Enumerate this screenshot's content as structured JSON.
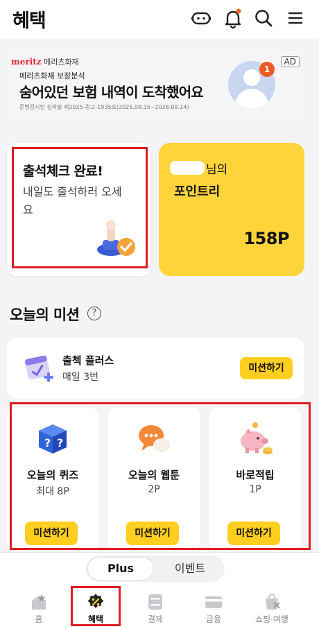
{
  "header": {
    "title": "혜택"
  },
  "ad": {
    "brand_logo": "meritz",
    "brand_name": "메리츠화재",
    "subtitle": "메리츠화재 보장분석",
    "headline": "숨어있던 보험 내역이 도착했어요",
    "legal": "준법감시인 심의필 제2025-광고-1935호(2025.09.15~2026.09.14)",
    "badge_count": "1",
    "ad_tag": "AD"
  },
  "attendance": {
    "title": "출석체크 완료!",
    "message": "내일도 출석하러 오세요"
  },
  "point": {
    "name_suffix": "님의",
    "label": "포인트리",
    "amount": "158P"
  },
  "missions": {
    "section_title": "오늘의 미션",
    "help": "?",
    "plus": {
      "title": "출첵 플러스",
      "subtitle": "매일 3번",
      "button": "미션하기"
    },
    "items": [
      {
        "title": "오늘의 퀴즈",
        "reward": "최대 8P",
        "button": "미션하기"
      },
      {
        "title": "오늘의 웹툰",
        "reward": "2P",
        "button": "미션하기"
      },
      {
        "title": "바로적립",
        "reward": "1P",
        "button": "미션하기"
      }
    ]
  },
  "segment": {
    "active": "Plus",
    "inactive": "이벤트"
  },
  "nav": [
    {
      "label": "홈",
      "icon": "home-icon"
    },
    {
      "label": "혜택",
      "icon": "benefit-icon"
    },
    {
      "label": "결제",
      "icon": "payment-icon"
    },
    {
      "label": "금융",
      "icon": "card-icon"
    },
    {
      "label": "쇼핑·여행",
      "icon": "shopping-icon"
    }
  ],
  "colors": {
    "accent_yellow": "#ffd43b",
    "button_yellow": "#ffce1f",
    "highlight_red": "#e01b22"
  }
}
